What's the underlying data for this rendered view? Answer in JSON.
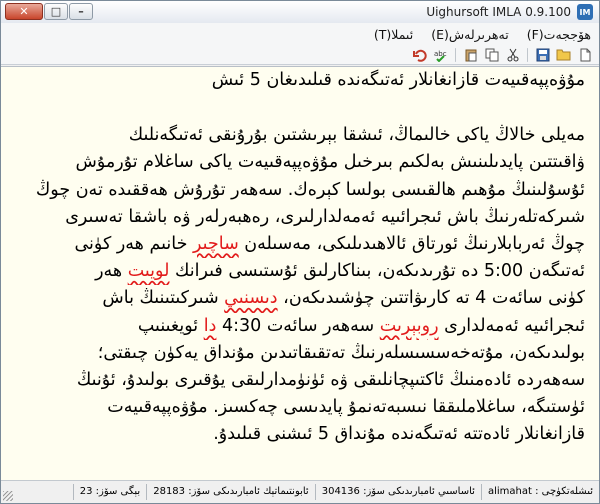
{
  "window": {
    "title": "Uighursoft IMLA 0.9.100",
    "app_icon_text": "IM"
  },
  "menu": {
    "items": [
      "ھۆججەت(F)",
      "تەھرىرلەش(E)",
      "ئىملا(T)"
    ]
  },
  "document": {
    "heading": "مۇۋەپپەقىيەت قازانغانلار ئەتىگەندە قىلىدىغان 5 ئىش",
    "lines": [
      "مەيلى خالاڭ ياكى خالىماڭ، ئىشقا بېرىشتىن بۇرۇنقى ئەتىگەنلىك",
      "ۋاقىتتىن پايدىلىنىش بەلكىم بىرخىل مۇۋەپپەقىيەت ياكى ساغلام تۇرمۇش",
      "ئۇسۇلىنىڭ مۇھىم ھالقىسى بولسا كېرەك. سەھەر تۇرۇش ھەققىدە تەن چوڭ",
      "شىركەتلەرنىڭ باش ئىجرائىيە ئەمەلدارلىرى، رەھبەرلەر ۋە باشقا تەسىرى",
      "چوڭ ئەربابلارنىڭ ئورتاق ئالاھىدىلىكى، مەسىلەن {ساچىر} خانىم ھەر كۈنى",
      "ئەتىگەن 5:00 دە تۇرىدىكەن، بىناكارلىق ئۇستىسى فىرانك {لويىت} ھەر",
      "كۈنى سائەت 4 تە كارىۋاتتىن چۈشىدىكەن، {دىسنىي} شىركىتىنىڭ باش",
      "ئىجرائىيە ئەمەلدارى {روبېرىت} سەھەر سائەت 4:30 {دا} ئويغىنىپ",
      "بولىدىكەن، مۇتەخەسسىسلەرنىڭ تەتقىقاتىدىن مۇنداق يەكۈن چىقتى؛",
      "سەھەردە ئادەمنىڭ ئاكتىپچانلىقى ۋە ئۈنۈمدارلىقى يۇقىرى بولىدۇ، ئۇنىڭ",
      "ئۈستىگە، ساغلاملىققا نىسبەتەنمۇ پايدىسى چەكسىز. مۇۋەپپەقىيەت",
      "قازانغانلار ئادەتتە ئەتىگەندە مۇنداق 5 ئىشنى قىلىدۇ."
    ]
  },
  "status": {
    "cells": [
      "ئىشلەتكۈچى : alimahat",
      "ئاساسىي ئامبارىدىكى سۆز: 304136",
      "ئابونتىماتېك ئامبارىدىكى سۆز: 28183",
      "بېگى سۆز: 23"
    ]
  },
  "colors": {
    "editor_bg": "#fffef0",
    "error": "#e21b1b"
  }
}
